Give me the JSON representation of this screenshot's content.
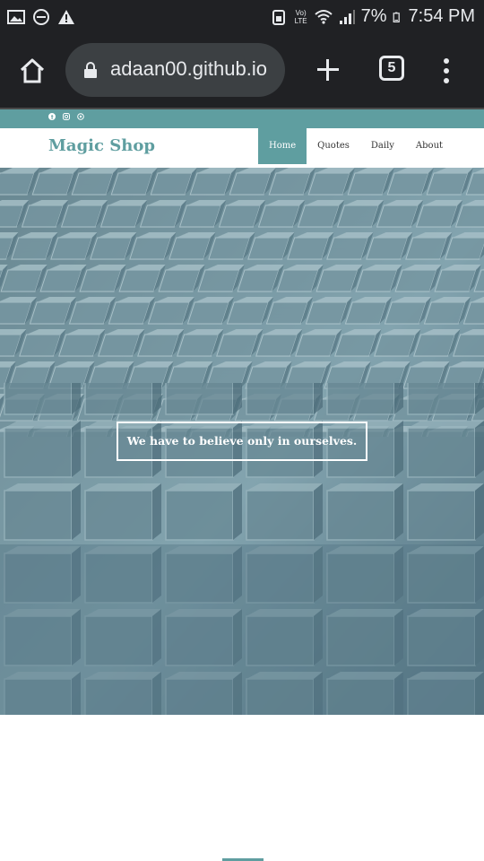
{
  "status_bar": {
    "battery": "7%",
    "time": "7:54 PM",
    "network_label": "Vo) LTE"
  },
  "browser": {
    "url": "adaan00.github.io",
    "tab_count": "5"
  },
  "site": {
    "brand": "Magic Shop",
    "nav": [
      {
        "label": "Home",
        "active": true
      },
      {
        "label": "Quotes",
        "active": false
      },
      {
        "label": "Daily",
        "active": false
      },
      {
        "label": "About",
        "active": false
      }
    ],
    "hero_quote": "We have to believe only in ourselves.",
    "social_icons": [
      "facebook-icon",
      "instagram-icon",
      "whatsapp-icon"
    ]
  },
  "colors": {
    "accent": "#5f9ea0",
    "chrome_bg": "#202124",
    "hero_tint": "#5b7d8c"
  }
}
